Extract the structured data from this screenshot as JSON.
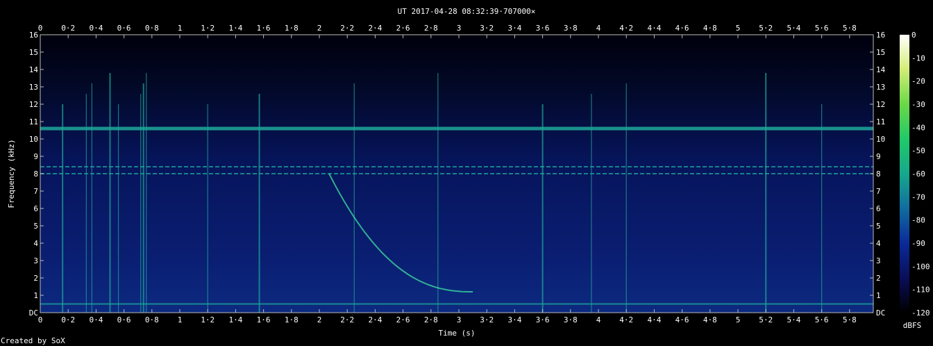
{
  "chart_data": {
    "type": "heatmap",
    "title": "UT 2017-04-28 08:32:39·707000×",
    "xlabel": "Time (s)",
    "ylabel": "Frequency (kHz)",
    "xlim": [
      0,
      5.97
    ],
    "ylim": [
      0,
      16
    ],
    "x_ticks": [
      "0",
      "0·2",
      "0·4",
      "0·6",
      "0·8",
      "1",
      "1·2",
      "1·4",
      "1·6",
      "1·8",
      "2",
      "2·2",
      "2·4",
      "2·6",
      "2·8",
      "3",
      "3·2",
      "3·4",
      "3·6",
      "3·8",
      "4",
      "4·2",
      "4·4",
      "4·6",
      "4·8",
      "5",
      "5·2",
      "5·4",
      "5·6",
      "5·8"
    ],
    "x_tick_values": [
      0,
      0.2,
      0.4,
      0.6,
      0.8,
      1,
      1.2,
      1.4,
      1.6,
      1.8,
      2,
      2.2,
      2.4,
      2.6,
      2.8,
      3,
      3.2,
      3.4,
      3.6,
      3.8,
      4,
      4.2,
      4.4,
      4.6,
      4.8,
      5,
      5.2,
      5.4,
      5.6,
      5.8
    ],
    "y_ticks": [
      "DC",
      "1",
      "2",
      "3",
      "4",
      "5",
      "6",
      "7",
      "8",
      "9",
      "10",
      "11",
      "12",
      "13",
      "14",
      "15",
      "16"
    ],
    "y_tick_values": [
      0,
      1,
      2,
      3,
      4,
      5,
      6,
      7,
      8,
      9,
      10,
      11,
      12,
      13,
      14,
      15,
      16
    ],
    "colorbar": {
      "label": "dBFS",
      "ticks": [
        "0",
        "-10",
        "-20",
        "-30",
        "-40",
        "-50",
        "-60",
        "-70",
        "-80",
        "-90",
        "-100",
        "-110",
        "-120"
      ],
      "tick_values": [
        0,
        -10,
        -20,
        -30,
        -40,
        -50,
        -60,
        -70,
        -80,
        -90,
        -100,
        -110,
        -120
      ],
      "range": [
        -120,
        0
      ]
    },
    "colors": {
      "background": "#000000",
      "noise_floor": "#0a1a5c",
      "signal": "#1fa89a",
      "strong_signal": "#3fe0a0"
    },
    "features": {
      "horizontal_lines_khz": [
        10.6,
        8.4,
        8.0,
        0.5
      ],
      "sferic_times_s": [
        0.16,
        0.33,
        0.37,
        0.5,
        0.56,
        0.72,
        0.74,
        0.76,
        1.2,
        1.57,
        2.25,
        2.85,
        3.6,
        3.95,
        4.2,
        5.2,
        5.6
      ],
      "whistler": {
        "start_time_s": 2.07,
        "start_freq_khz": 8.0,
        "end_time_s": 3.1,
        "end_freq_khz": 1.2
      }
    }
  },
  "credit": "Created by SoX"
}
